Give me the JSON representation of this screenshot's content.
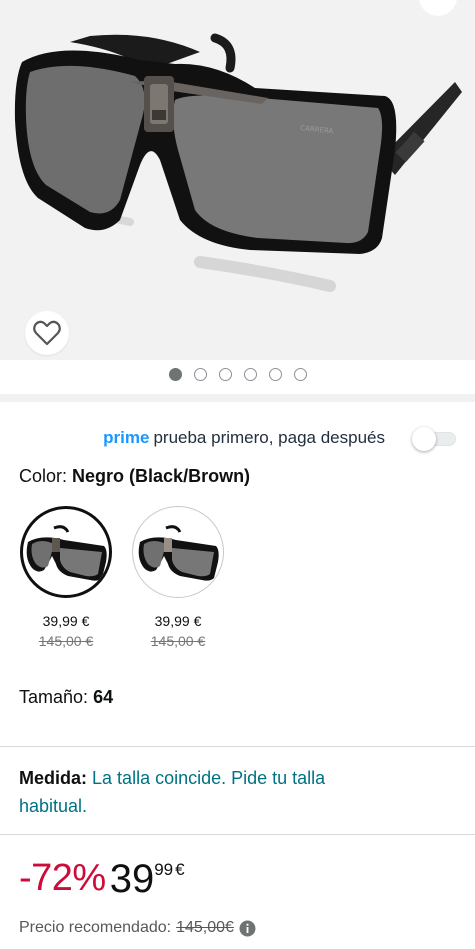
{
  "gallery": {
    "image_count": 6,
    "active_index": 0,
    "wishlist_icon": "heart-outline-icon",
    "brand_mark": "CARRERA"
  },
  "prime": {
    "logo": "prime",
    "text": "prueba primero, paga después",
    "toggle_on": false
  },
  "color": {
    "label": "Color:",
    "value": "Negro (Black/Brown)",
    "swatches": [
      {
        "price": "39,99 €",
        "old_price": "145,00 €",
        "selected": true
      },
      {
        "price": "39,99 €",
        "old_price": "145,00 €",
        "selected": false
      }
    ]
  },
  "size": {
    "label": "Tamaño:",
    "value": "64"
  },
  "fit": {
    "label": "Medida:",
    "link_text": "La talla coincide. Pide tu talla habitual."
  },
  "price": {
    "discount": "-72%",
    "whole": "39",
    "fraction": "99",
    "currency": "€",
    "rrp_label": "Precio recomendado:",
    "rrp_value": "145,00€",
    "info_icon": "info-icon"
  },
  "colors": {
    "discount_red": "#cc0c39",
    "link_teal": "#007185",
    "prime_blue": "#1a98ff"
  }
}
